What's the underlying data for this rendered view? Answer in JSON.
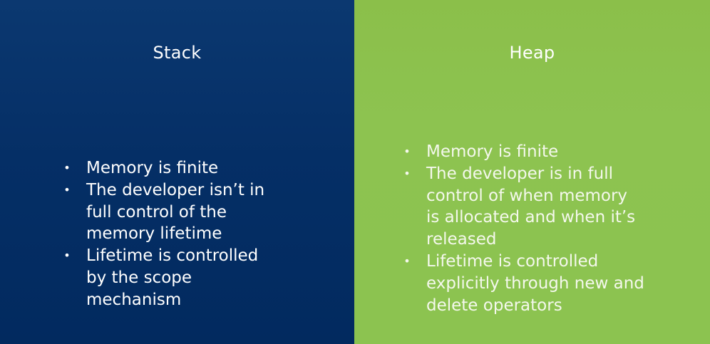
{
  "stack": {
    "title": "Stack",
    "bullets": [
      "Memory is finite",
      "The developer isn’t in full control of the memory lifetime",
      "Lifetime is controlled by the scope mechanism"
    ]
  },
  "heap": {
    "title": "Heap",
    "bullets": [
      "Memory is finite",
      "The developer is in full control of when memory is allocated and when it’s released",
      "Lifetime is controlled explicitly through new and delete operators"
    ]
  },
  "colors": {
    "stack_bg": "#052f66",
    "heap_bg": "#8cc350",
    "text": "#ffffff"
  }
}
